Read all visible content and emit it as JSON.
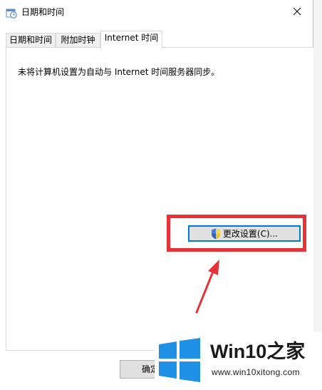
{
  "window": {
    "title": "日期和时间",
    "title_icon": "date-time-icon",
    "close_icon": "close-icon"
  },
  "tabs": [
    {
      "label": "日期和时间",
      "active": false
    },
    {
      "label": "附加时钟",
      "active": false
    },
    {
      "label": "Internet 时间",
      "active": true
    }
  ],
  "internet_time": {
    "message": "未将计算机设置为自动与 Internet 时间服务器同步。",
    "change_button_label": "更改设置(C)...",
    "change_button_icon": "uac-shield-icon"
  },
  "footer": {
    "ok_label": "确定"
  },
  "watermark": {
    "title": "Win10之家",
    "url": "www.win10xitong.com"
  },
  "colors": {
    "highlight": "#e8323a",
    "focus_border": "#0078d7",
    "windows_blue": "#1e90e6"
  }
}
